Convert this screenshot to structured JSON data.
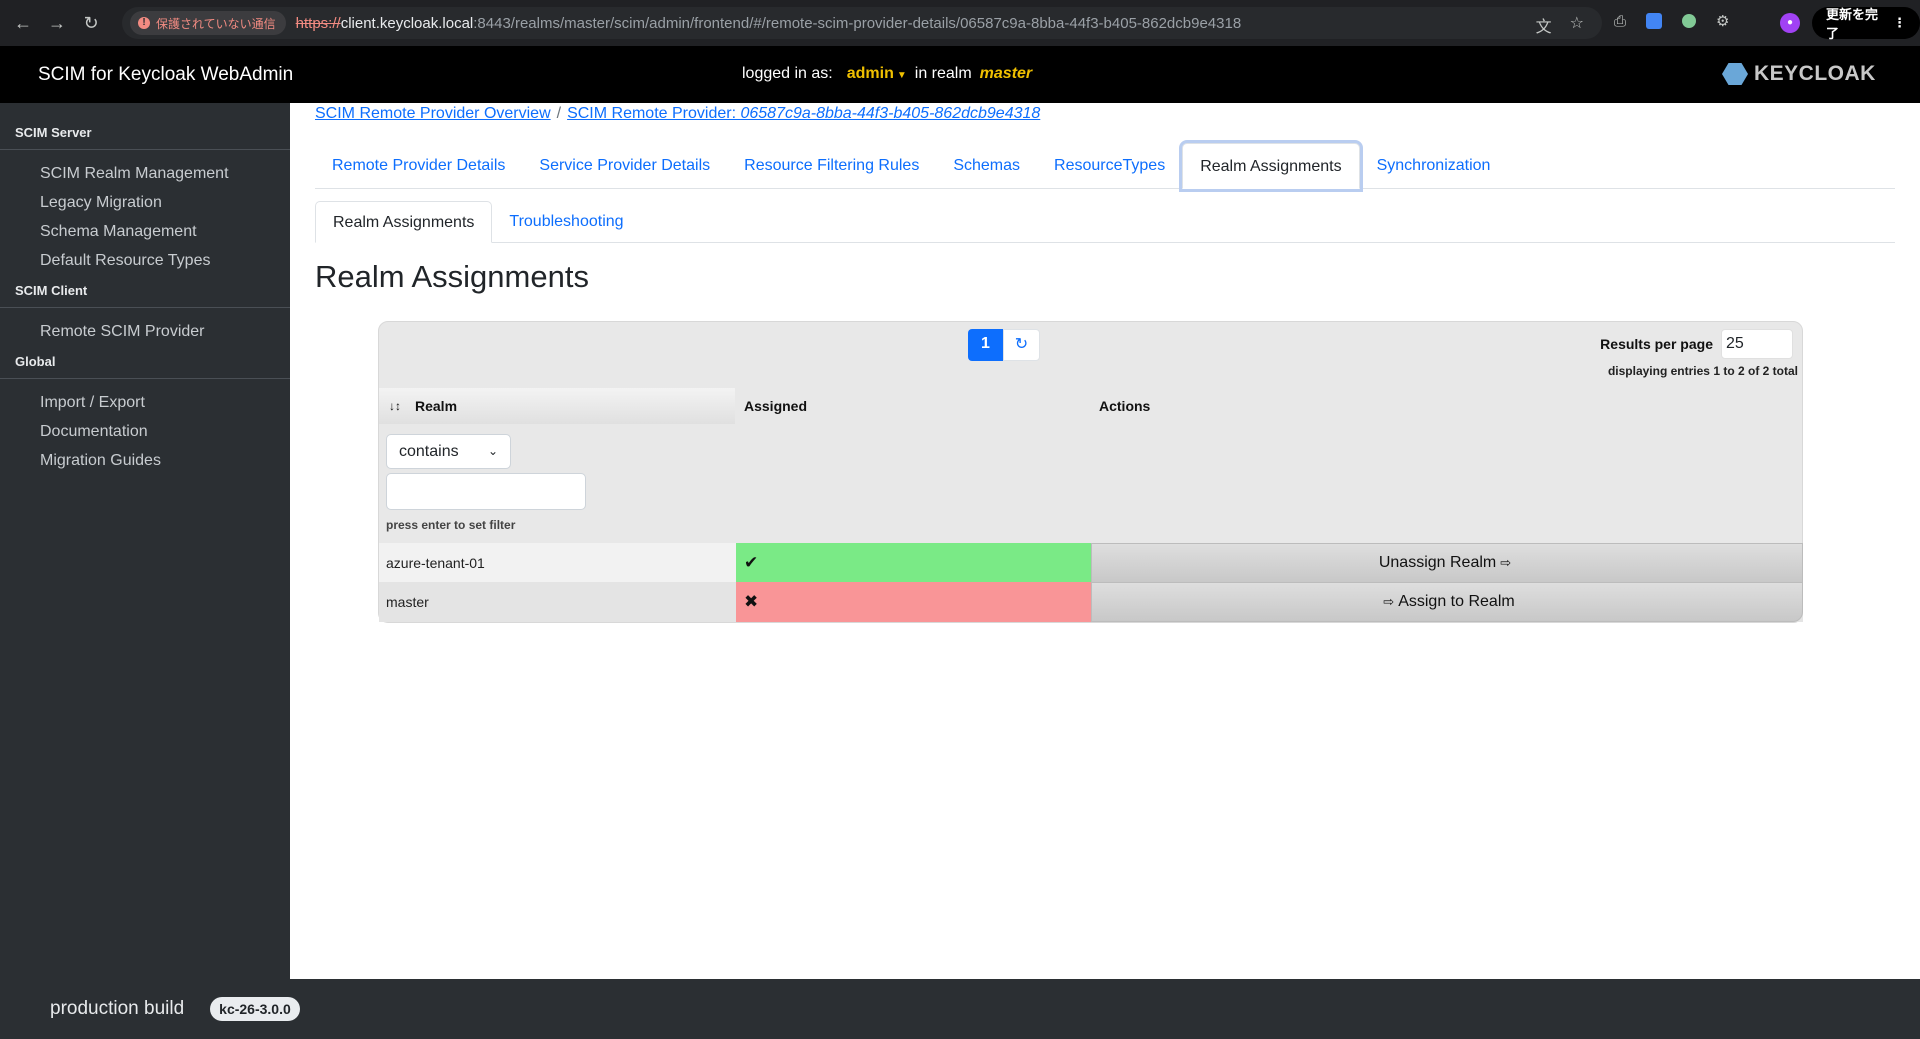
{
  "browser": {
    "insecure_label": "保護されていない通信",
    "url_scheme": "https://",
    "url_host": "client.keycloak.local",
    "url_rest": ":8443/realms/master/scim/admin/frontend/#/remote-scim-provider-details/06587c9a-8bba-44f3-b405-862dcb9e4318",
    "update_label": "更新を完了"
  },
  "header": {
    "app_title": "SCIM for Keycloak WebAdmin",
    "logged_in_as": "logged in as:",
    "user": "admin",
    "in_realm": "in realm",
    "realm": "master",
    "logo_text": "KEYCLOAK"
  },
  "sidebar": {
    "sections": [
      {
        "title": "SCIM Server",
        "items": [
          "SCIM Realm Management",
          "Legacy Migration",
          "Schema Management",
          "Default Resource Types"
        ]
      },
      {
        "title": "SCIM Client",
        "items": [
          "Remote SCIM Provider"
        ]
      },
      {
        "title": "Global",
        "items": [
          "Import / Export",
          "Documentation",
          "Migration Guides"
        ]
      }
    ]
  },
  "breadcrumb": {
    "overview": "SCIM Remote Provider Overview",
    "separator": "/",
    "provider_prefix": "SCIM Remote Provider: ",
    "provider_id": "06587c9a-8bba-44f3-b405-862dcb9e4318"
  },
  "tabs": [
    "Remote Provider Details",
    "Service Provider Details",
    "Resource Filtering Rules",
    "Schemas",
    "ResourceTypes",
    "Realm Assignments",
    "Synchronization"
  ],
  "active_tab": "Realm Assignments",
  "subtabs": [
    "Realm Assignments",
    "Troubleshooting"
  ],
  "active_subtab": "Realm Assignments",
  "page_title": "Realm Assignments",
  "table": {
    "current_page": "1",
    "results_per_page_label": "Results per page",
    "results_per_page": "25",
    "entries_info": "displaying entries 1 to 2 of 2 total",
    "columns": {
      "realm": "Realm",
      "assigned": "Assigned",
      "actions": "Actions"
    },
    "filter_mode": "contains",
    "filter_value": "",
    "filter_hint": "press enter to set filter",
    "rows": [
      {
        "realm": "azure-tenant-01",
        "assigned": true,
        "assigned_mark": "✔",
        "action": "Unassign Realm"
      },
      {
        "realm": "master",
        "assigned": false,
        "assigned_mark": "✖",
        "action": "Assign to Realm"
      }
    ],
    "colors": {
      "assigned_yes": "#7aea86",
      "assigned_no": "#f99597",
      "primary": "#0d6efd"
    }
  },
  "footer": {
    "build_label": "production build",
    "version": "kc-26-3.0.0"
  }
}
